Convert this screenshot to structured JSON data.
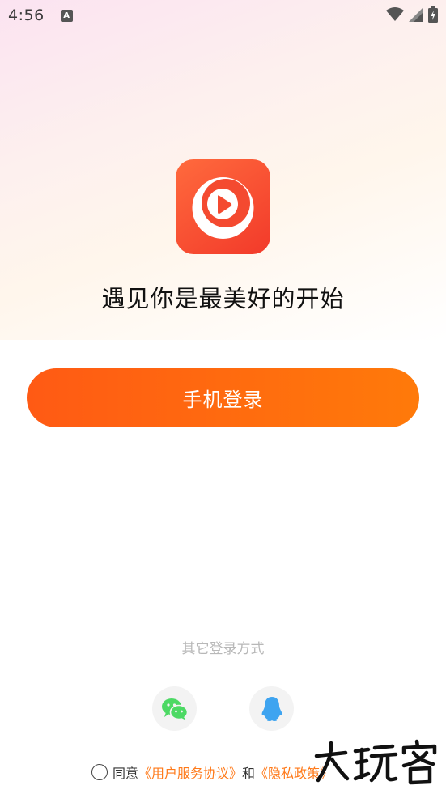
{
  "status_bar": {
    "time": "4:56",
    "notification_glyph": "A",
    "icons": [
      "wifi-icon",
      "signal-icon",
      "battery-charging-icon"
    ]
  },
  "app": {
    "logo_icon": "play-logo-icon",
    "slogan": "遇见你是最美好的开始"
  },
  "login": {
    "phone_login_label": "手机登录",
    "other_methods_label": "其它登录方式",
    "social": [
      {
        "name": "wechat",
        "icon": "wechat-icon",
        "color": "#4cd964"
      },
      {
        "name": "qq",
        "icon": "qq-icon",
        "color": "#3ea4f0"
      }
    ]
  },
  "agreement": {
    "prefix": "同意",
    "user_agreement": "《用户服务协议》",
    "conjunction": "和",
    "privacy_policy": "《隐私政策》"
  },
  "watermark": {
    "text": "大玩客"
  },
  "colors": {
    "brand_orange": "#ff6a14",
    "link_orange": "#ff7a1a",
    "logo_red": "#f23a2a"
  }
}
